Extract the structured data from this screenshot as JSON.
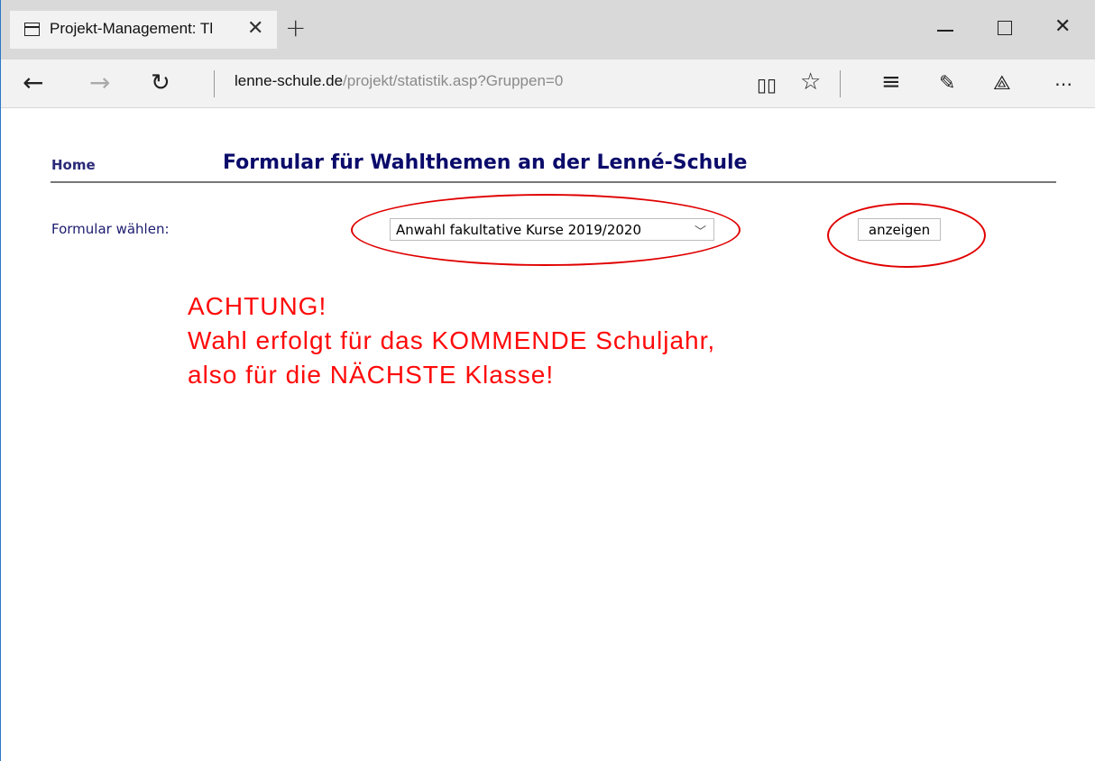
{
  "browser": {
    "tab_title": "Projekt-Management: Tl",
    "tab_close_icon": "close-icon",
    "new_tab_label": "+",
    "address_host": "lenne-schule.de",
    "address_path": "/projekt/statistik.asp?Gruppen=0",
    "icons": [
      "back-arrow-icon",
      "forward-arrow-icon",
      "refresh-icon",
      "reading-view-icon",
      "favorite-star-icon",
      "hub-icon",
      "web-note-icon",
      "share-icon",
      "more-icon"
    ]
  },
  "page": {
    "home_link": "Home",
    "title": "Formular für Wahlthemen an der Lenné-Schule",
    "form_label": "Formular wählen:",
    "select_value": "Anwahl fakultative Kurse 2019/2020",
    "show_button": "anzeigen",
    "warning_lines": [
      "ACHTUNG!",
      "Wahl erfolgt für das KOMMENDE Schuljahr,",
      "also für die NÄCHSTE Klasse!"
    ]
  },
  "colors": {
    "annotation_red": "#e00000",
    "warning_red": "#ff0a0a",
    "title_navy": "#0b0b6b"
  }
}
